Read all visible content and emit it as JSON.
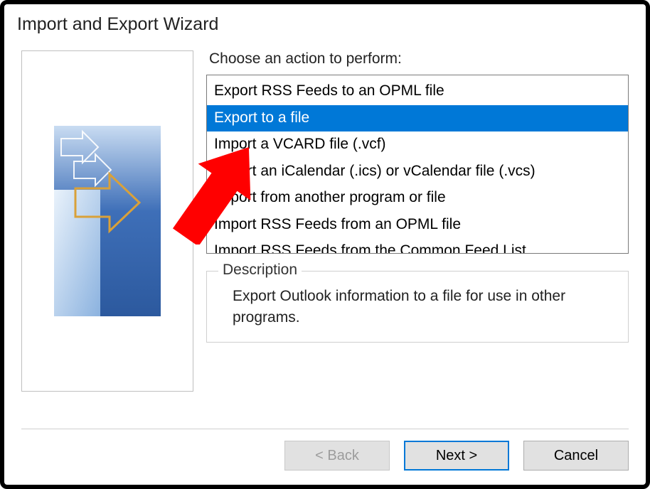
{
  "window": {
    "title": "Import and Export Wizard"
  },
  "prompt": "Choose an action to perform:",
  "actions": {
    "items": [
      {
        "label": "Export RSS Feeds to an OPML file",
        "selected": false
      },
      {
        "label": "Export to a file",
        "selected": true
      },
      {
        "label": "Import a VCARD file (.vcf)",
        "selected": false
      },
      {
        "label": "Import an iCalendar (.ics) or vCalendar file (.vcs)",
        "selected": false
      },
      {
        "label": "Import from another program or file",
        "selected": false
      },
      {
        "label": "Import RSS Feeds from an OPML file",
        "selected": false
      },
      {
        "label": "Import RSS Feeds from the Common Feed List",
        "selected": false
      }
    ]
  },
  "description": {
    "legend": "Description",
    "text": "Export Outlook information to a file for use in other programs."
  },
  "buttons": {
    "back": "< Back",
    "next": "Next >",
    "cancel": "Cancel"
  },
  "annotation": {
    "arrow": "red-arrow-pointing-to-selection"
  }
}
